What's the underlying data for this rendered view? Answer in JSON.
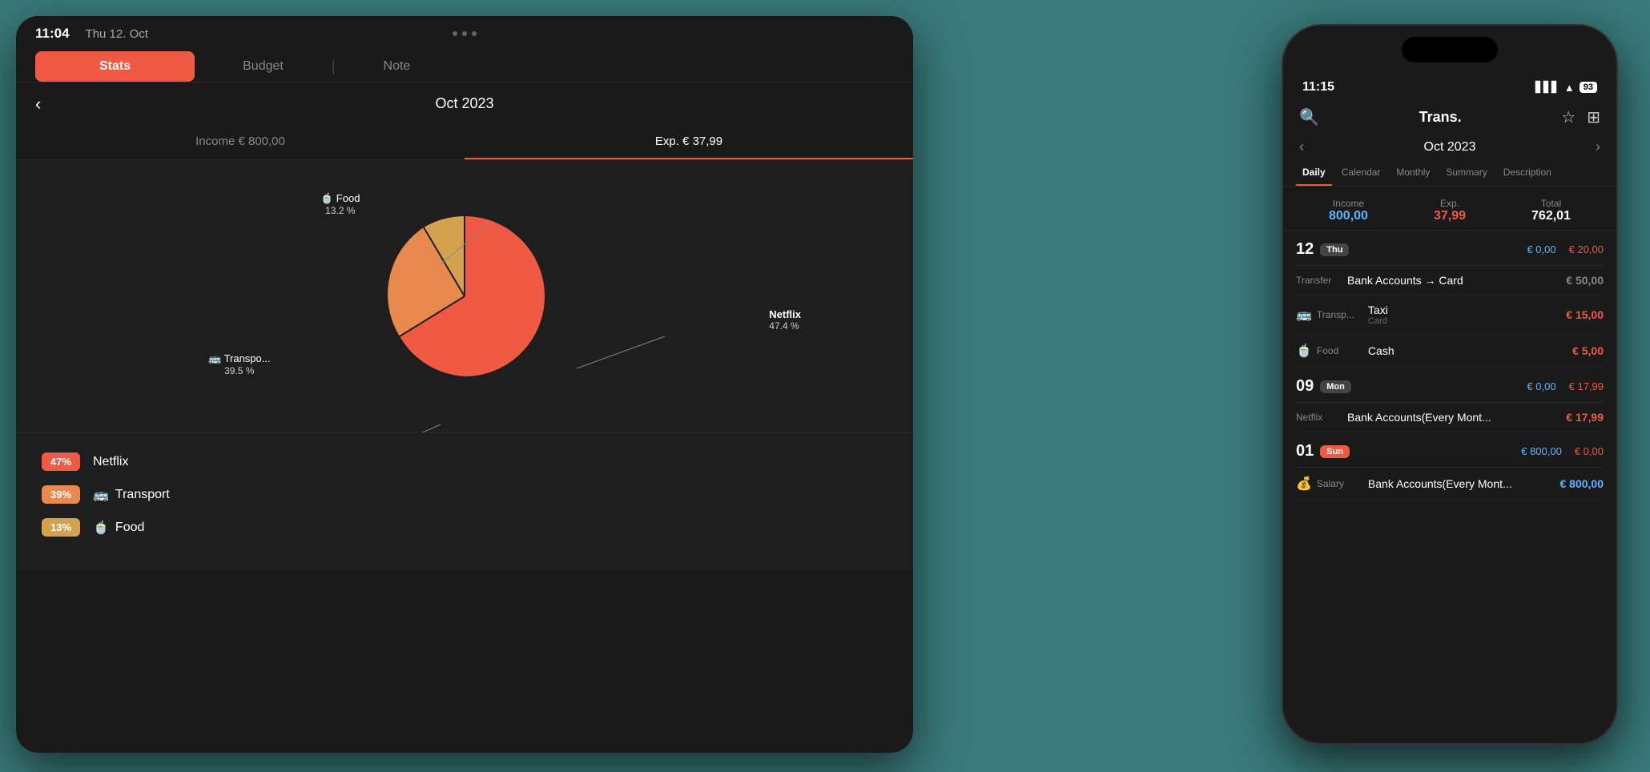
{
  "tablet": {
    "status": {
      "time": "11:04",
      "date": "Thu 12. Oct"
    },
    "tabs": [
      "Stats",
      "Budget",
      "Note"
    ],
    "active_tab": "Stats",
    "header": {
      "back": "‹",
      "month": "Oct 2023"
    },
    "income_tab": "Income € 800,00",
    "expense_tab": "Exp. € 37,99",
    "chart": {
      "segments": [
        {
          "label": "Food",
          "icon": "🍵",
          "pct": "13.2 %",
          "color": "#d4a24e",
          "value": 13.2
        },
        {
          "label": "Netflix",
          "pct": "47.4 %",
          "color": "#f05a44",
          "value": 47.4
        },
        {
          "label": "Transpo...",
          "icon": "🚌",
          "pct": "39.5 %",
          "color": "#e8894e",
          "value": 39.5
        }
      ]
    },
    "legend": [
      {
        "badge": "47%",
        "badge_class": "badge-netflix",
        "icon": "",
        "label": "Netflix"
      },
      {
        "badge": "39%",
        "badge_class": "badge-transport",
        "icon": "🚌",
        "label": "Transport"
      },
      {
        "badge": "13%",
        "badge_class": "badge-food",
        "icon": "🍵",
        "label": "Food"
      }
    ]
  },
  "phone": {
    "status": {
      "time": "11:15",
      "battery": "93",
      "signal": "▋▋▋",
      "wifi": "wifi"
    },
    "toolbar": {
      "search": "🔍",
      "title": "Trans.",
      "star": "☆",
      "filter": "⊞"
    },
    "month": "Oct 2023",
    "tabs": [
      "Daily",
      "Calendar",
      "Monthly",
      "Summary",
      "Description"
    ],
    "active_tab": "Daily",
    "summary": {
      "income_label": "Income",
      "income_val": "800,00",
      "exp_label": "Exp.",
      "exp_val": "37,99",
      "total_label": "Total",
      "total_val": "762,01"
    },
    "day_groups": [
      {
        "day": "12",
        "day_badge": "Thu",
        "income": "€ 0,00",
        "exp": "€ 20,00",
        "transactions": [
          {
            "type": "transfer",
            "cat_label": "Transfer",
            "name": "Bank Accounts → Card",
            "account": "",
            "amount": "€ 50,00",
            "amount_color": "gray"
          },
          {
            "type": "expense",
            "cat_icon": "🚌",
            "cat_label": "Transp...",
            "name": "Taxi",
            "account": "Card",
            "amount": "€ 15,00"
          },
          {
            "type": "expense",
            "cat_icon": "🍵",
            "cat_label": "Food",
            "name": "Cash",
            "account": "",
            "amount": "€ 5,00"
          }
        ]
      },
      {
        "day": "09",
        "day_badge": "Mon",
        "income": "€ 0,00",
        "exp": "€ 17,99",
        "transactions": [
          {
            "type": "expense",
            "cat_label": "Netflix",
            "name": "Bank Accounts(Every Mont...",
            "account": "",
            "amount": "€ 17,99"
          }
        ]
      },
      {
        "day": "01",
        "day_badge": "Sun",
        "day_badge_class": "sun-badge",
        "income": "€ 800,00",
        "exp": "€ 0,00",
        "transactions": [
          {
            "type": "income",
            "cat_icon": "💰",
            "cat_label": "Salary",
            "name": "Bank Accounts(Every Mont...",
            "account": "",
            "amount": "€ 800,00",
            "amount_color": "blue"
          }
        ]
      }
    ]
  }
}
